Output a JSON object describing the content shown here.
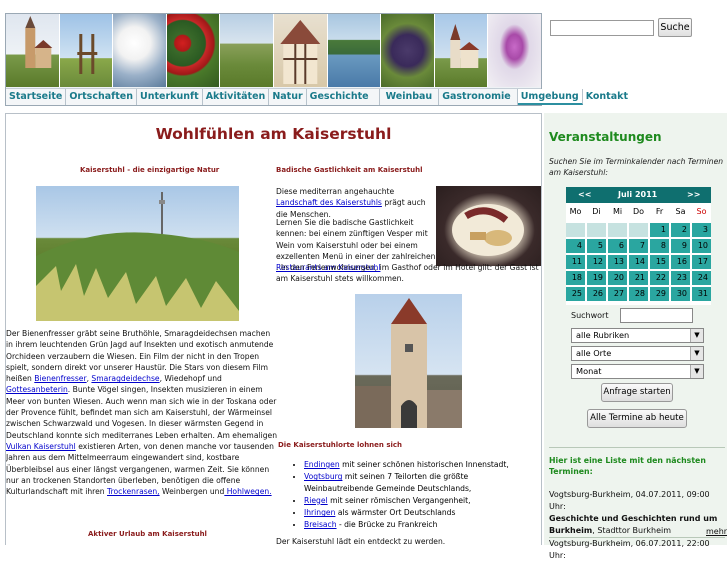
{
  "nav": {
    "items": [
      "Startseite",
      "Ortschaften",
      "Unterkunft",
      "Aktivitäten",
      "Natur",
      "Geschichte",
      "Weinbau",
      "Gastronomie",
      "Umgebung",
      "Kontakt"
    ]
  },
  "search": {
    "button": "Suche",
    "value": ""
  },
  "main": {
    "title": "Wohlfühlen am Kaiserstuhl",
    "left": {
      "heading": "Kaiserstuhl - die einzigartige Natur",
      "p1_a": "Der Bienenfresser gräbt seine Bruthöhle, Smaragdeidechsen machen in ihrem leuchtenden Grün Jagd auf Insekten und exotisch anmutende Orchideen verzaubern die Wiesen. Ein Film der nicht in den Tropen spielt, sondern direkt vor unserer Haustür. Die Stars von diesem Film heißen",
      "link_bienenfresser": "Bienenfresser",
      "link_smaragdeidechse": "Smaragdeidechse",
      "p1_b": ", Wiedehopf und",
      "link_gottesanbeterin": "Gottesanbeterin",
      "p1_c": ". Bunte Vögel singen, Insekten musizieren in einem Meer von bunten Wiesen. Auch wenn man sich wie in der Toskana oder der Provence fühlt, befindet man sich am Kaiserstuhl, der Wärmeinsel zwischen Schwarzwald und Vogesen. In dieser wärmsten Gegend in Deutschland konnte sich mediterranes Leben erhalten. Am ehemaligen",
      "link_vulkan": "Vulkan Kaiserstuhl",
      "p1_d": " existieren Arten, von denen manche vor tausenden Jahren aus dem Mittelmeerraum eingewandert sind, kostbare Überbleibsel aus einer längst vergangenen, warmen Zeit. Sie können nur an trockenen Standorten überleben, benötigen die offene Kulturlandschaft mit ihren",
      "link_trockenrasen": "Trockenrasen,",
      "p1_e": " Weinbergen und",
      "link_hohlwegen": " Hohlwegen.",
      "heading2": "Aktiver Urlaub am Kaiserstuhl"
    },
    "right": {
      "heading": "Badische Gastlichkeit am Kaiserstuhl",
      "p1_a": "Diese mediterran angehauchte",
      "link_landschaft": " Landschaft des Kaiserstuhls",
      "p1_b": " prägt auch die Menschen.",
      "p2_a": "Lernen Sie die badische Gastlichkeit kennen: bei einem zünftigen Vesper mit Wein vom Kaiserstuhl oder bei einem exzellenten Menü in einer der zahlreichen",
      "link_restaurants": " Restaurants am Kaiserstuhl",
      "p2_b": ". In den Ferienwohnungen, im Gasthof oder im Hotel gilt: der Gast ist am Kaiserstuhl stets willkommen.",
      "heading2": "Die Kaiserstuhlorte lohnen sich",
      "orte": [
        {
          "link": "Endingen",
          "text": " mit seiner schönen historischen Innenstadt,"
        },
        {
          "link": "Vogtsburg",
          "text": " mit seinen 7 Teilorten die größte Weinbautreibende Gemeinde Deutschlands,"
        },
        {
          "link": "Riegel",
          "text": " mit seiner römischen Vergangenheit,"
        },
        {
          "link": "Ihringen",
          "text": " als wärmster Ort Deutschlands"
        },
        {
          "link": "Breisach",
          "text": " - die Brücke zu Frankreich"
        }
      ],
      "footer": "Der Kaiserstuhl lädt ein entdeckt zu werden."
    }
  },
  "sidebar": {
    "title": "Veranstaltungen",
    "subtitle": "Suchen Sie im Terminkalender nach Terminen am Kaiserstuhl:",
    "calendar": {
      "prev": "<<",
      "month": "Juli 2011",
      "next": ">>",
      "weekdays": [
        "Mo",
        "Di",
        "Mi",
        "Do",
        "Fr",
        "Sa",
        "So"
      ],
      "weeks": [
        [
          "",
          "",
          "",
          "",
          "1",
          "2",
          "3"
        ],
        [
          "4",
          "5",
          "6",
          "7",
          "8",
          "9",
          "10"
        ],
        [
          "11",
          "12",
          "13",
          "14",
          "15",
          "16",
          "17"
        ],
        [
          "18",
          "19",
          "20",
          "21",
          "22",
          "23",
          "24"
        ],
        [
          "25",
          "26",
          "27",
          "28",
          "29",
          "30",
          "31"
        ]
      ]
    },
    "suchwort_label": "Suchwort",
    "rubrik": "alle Rubriken",
    "orte": "alle Orte",
    "zeitraum": "Monat",
    "btn_start": "Anfrage starten",
    "btn_all": "Alle Termine ab heute",
    "list_heading": "Hier ist eine Liste mit den nächsten Terminen:",
    "event1_a": "Vogtsburg-Burkheim, 04.07.2011, 09:00 Uhr:",
    "event1_b": "Geschichte und Geschichten rund um Burkheim",
    "event1_c": ", Stadttor Burkheim",
    "mehr": "mehr",
    "event2_a": "Vogtsburg-Burkheim, 06.07.2011, 22:00 Uhr:"
  },
  "colors": {
    "accent": "#8a1c1c",
    "nav": "#1a7a8a",
    "sidebar_title": "#1e8a1e",
    "calendar": "#2aa6a0"
  }
}
